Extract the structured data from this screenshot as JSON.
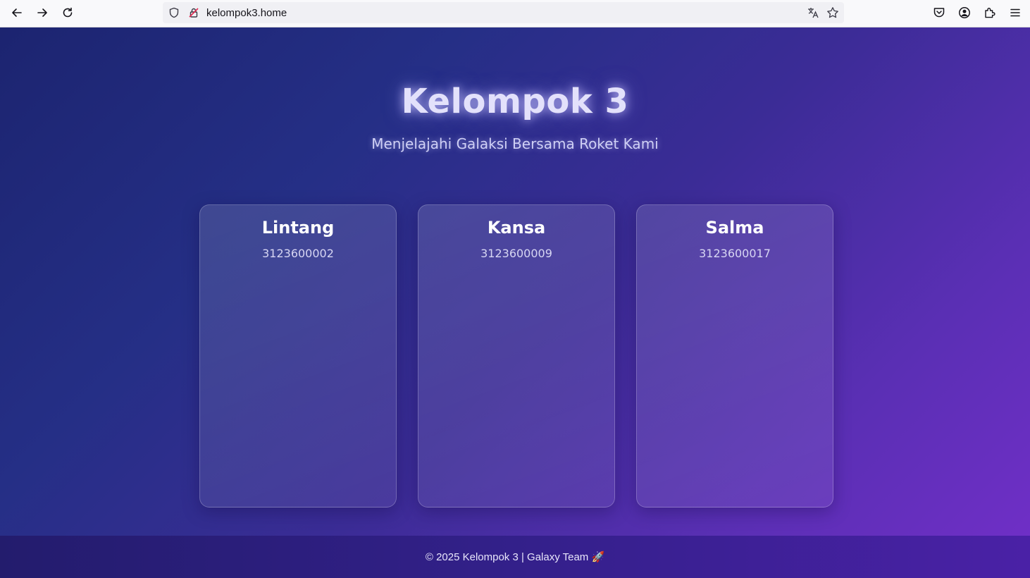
{
  "browser": {
    "url": "kelompok3.home",
    "icons": [
      "back-icon",
      "forward-icon",
      "reload-icon",
      "shield-icon",
      "insecure-lock-icon",
      "translate-icon",
      "bookmark-star-icon",
      "pocket-icon",
      "account-icon",
      "extensions-icon",
      "menu-icon"
    ]
  },
  "hero": {
    "title": "Kelompok 3",
    "subtitle": "Menjelajahi Galaksi Bersama Roket Kami"
  },
  "members": [
    {
      "name": "Lintang",
      "nim": "3123600002"
    },
    {
      "name": "Kansa",
      "nim": "3123600009"
    },
    {
      "name": "Salma",
      "nim": "3123600017"
    }
  ],
  "footer": {
    "text": "© 2025 Kelompok 3 | Galaxy Team 🚀"
  },
  "colors": {
    "gradient_start": "#1c2470",
    "gradient_end": "#6f2fc6",
    "title_glow": "#e3e1fb"
  }
}
